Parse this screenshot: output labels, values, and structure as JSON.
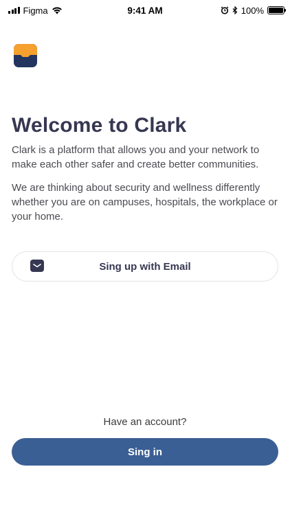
{
  "status_bar": {
    "carrier": "Figma",
    "time": "9:41 AM",
    "battery": "100%",
    "icons": [
      "signal-icon",
      "wifi-icon",
      "alarm-icon",
      "bluetooth-icon",
      "battery-icon"
    ]
  },
  "brand": {
    "logo_icon": "clark-logo-icon",
    "colors": {
      "orange": "#f5a02f",
      "navy": "#23345f"
    }
  },
  "welcome": {
    "title": "Welcome to Clark",
    "paragraph1": "Clark is a platform that allows you and your network to make each other safer and create better communities.",
    "paragraph2": "We are thinking  about  security and wellness differently whether you are on campuses, hospitals, the workplace or your home."
  },
  "signup": {
    "email_label": "Sing up with Email",
    "icon": "mail-icon"
  },
  "footer": {
    "have_account": "Have an account?",
    "signin_label": "Sing in",
    "accent": "#3a5f94"
  }
}
